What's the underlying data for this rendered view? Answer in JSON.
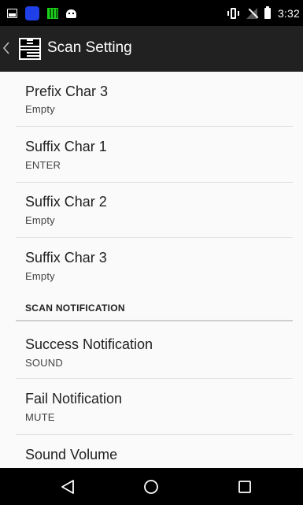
{
  "status_bar": {
    "time": "3:32",
    "left_icons": [
      "image-icon",
      "blue-app-icon",
      "qr-app-icon",
      "android-bot-icon"
    ],
    "right_icons": [
      "vibrate-icon",
      "no-signal-icon",
      "battery-icon"
    ]
  },
  "action_bar": {
    "title": "Scan Setting",
    "icon": "qr-code-icon"
  },
  "preferences": [
    {
      "title": "Prefix Char 3",
      "summary": "Empty"
    },
    {
      "title": "Suffix Char 1",
      "summary": "ENTER"
    },
    {
      "title": "Suffix Char 2",
      "summary": "Empty"
    },
    {
      "title": "Suffix Char 3",
      "summary": "Empty"
    }
  ],
  "category": {
    "label": "SCAN NOTIFICATION"
  },
  "notification_preferences": [
    {
      "title": "Success Notification",
      "summary": "SOUND"
    },
    {
      "title": "Fail Notification",
      "summary": "MUTE"
    },
    {
      "title": "Sound Volume"
    }
  ],
  "nav_bar": {
    "buttons": [
      "back-icon",
      "home-icon",
      "recents-icon"
    ]
  },
  "colors": {
    "status_bar": "#000000",
    "action_bar": "#212121",
    "content_bg": "#fafafa",
    "nav_bar": "#000000"
  }
}
